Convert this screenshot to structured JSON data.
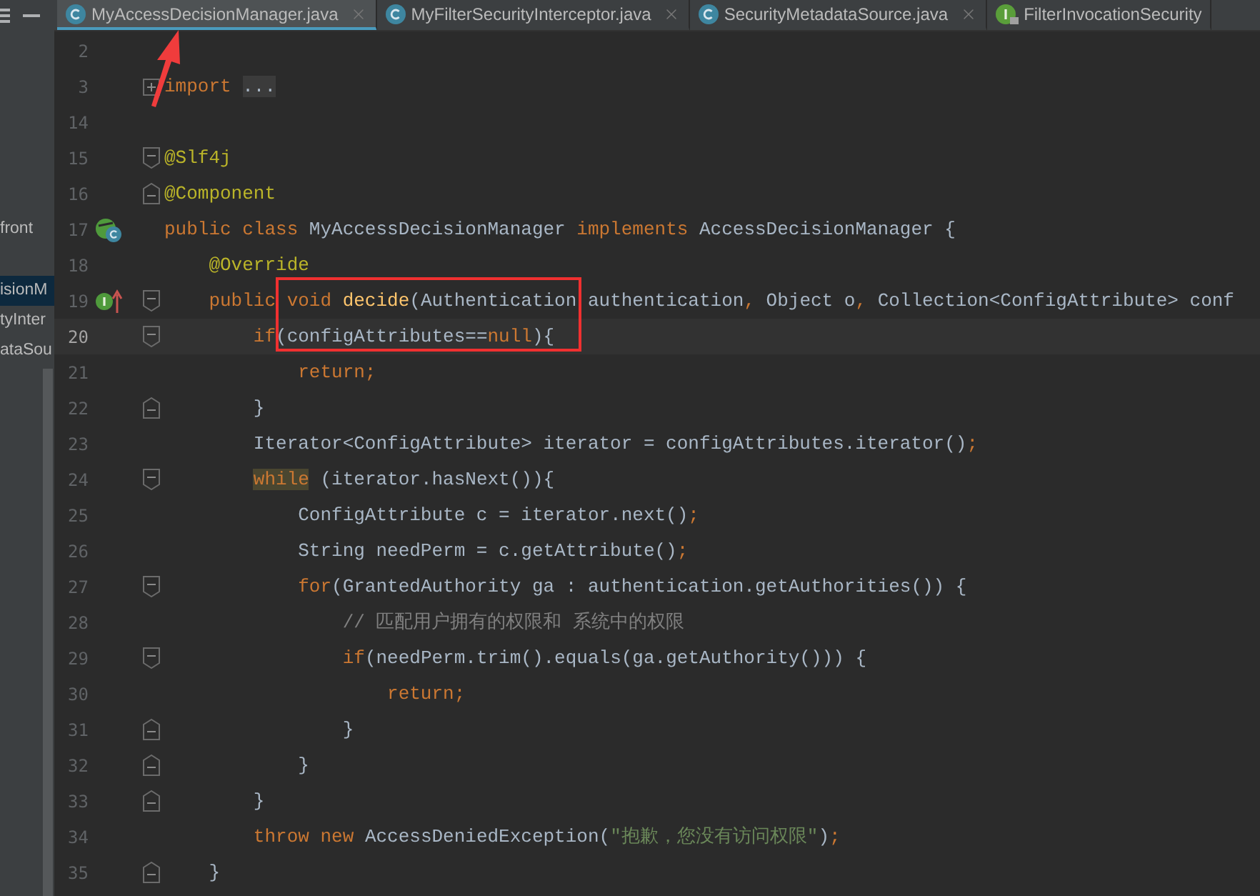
{
  "sidebar": {
    "items": [
      {
        "label": "front",
        "selected": false
      },
      {
        "label": "isionM",
        "selected": true
      },
      {
        "label": "tyInter",
        "selected": false
      },
      {
        "label": "ataSou",
        "selected": false
      }
    ]
  },
  "tabs": [
    {
      "label": "MyAccessDecisionManager.java",
      "kind": "class",
      "selected": true,
      "closable": true
    },
    {
      "label": "MyFilterSecurityInterceptor.java",
      "kind": "class",
      "selected": false,
      "closable": true
    },
    {
      "label": "SecurityMetadataSource.java",
      "kind": "class",
      "selected": false,
      "closable": true
    },
    {
      "label": "FilterInvocationSecurity",
      "kind": "interface",
      "selected": false,
      "closable": false
    }
  ],
  "editor": {
    "lines": [
      {
        "number": "2",
        "current": false
      },
      {
        "number": "3",
        "current": false,
        "markers": [
          {
            "kind": "fold_collapsed"
          }
        ],
        "tokens": [
          {
            "kind": "keyword",
            "text": "import "
          },
          {
            "kind": "folded",
            "text": "..."
          }
        ]
      },
      {
        "number": "14",
        "current": false
      },
      {
        "number": "15",
        "current": false,
        "markers": [
          {
            "kind": "fold_start"
          }
        ],
        "tokens": [
          {
            "kind": "annotation",
            "text": "@Slf4j"
          }
        ]
      },
      {
        "number": "16",
        "current": false,
        "markers": [
          {
            "kind": "fold_end"
          }
        ],
        "tokens": [
          {
            "kind": "annotation",
            "text": "@Component"
          }
        ]
      },
      {
        "number": "17",
        "current": false,
        "markers": [
          {
            "kind": "class_implements"
          }
        ],
        "tokens": [
          {
            "kind": "keyword",
            "text": "public class "
          },
          {
            "kind": "plain",
            "text": "MyAccessDecisionManager "
          },
          {
            "kind": "keyword",
            "text": "implements "
          },
          {
            "kind": "plain",
            "text": "AccessDecisionManager {"
          }
        ]
      },
      {
        "number": "18",
        "current": false,
        "tokens": [
          {
            "kind": "annotation",
            "text": "    @Override"
          }
        ]
      },
      {
        "number": "19",
        "current": false,
        "markers": [
          {
            "kind": "method_implements"
          },
          {
            "kind": "fold_start"
          }
        ],
        "tokens": [
          {
            "kind": "keyword",
            "text": "    public void "
          },
          {
            "kind": "method",
            "text": "decide"
          },
          {
            "kind": "plain",
            "text": "(Authentication authentication"
          },
          {
            "kind": "keyword",
            "text": ", "
          },
          {
            "kind": "plain",
            "text": "Object o"
          },
          {
            "kind": "keyword",
            "text": ", "
          },
          {
            "kind": "plain",
            "text": "Collection<ConfigAttribute> conf"
          }
        ]
      },
      {
        "number": "20",
        "current": true,
        "markers": [
          {
            "kind": "fold_start"
          }
        ],
        "tokens": [
          {
            "kind": "keyword",
            "text": "        if"
          },
          {
            "kind": "plain",
            "text": "(configAttributes=="
          },
          {
            "kind": "keyword",
            "text": "null"
          },
          {
            "kind": "plain",
            "text": "){"
          }
        ]
      },
      {
        "number": "21",
        "current": false,
        "tokens": [
          {
            "kind": "keyword",
            "text": "            return;"
          }
        ]
      },
      {
        "number": "22",
        "current": false,
        "markers": [
          {
            "kind": "fold_end"
          }
        ],
        "tokens": [
          {
            "kind": "plain",
            "text": "        }"
          }
        ]
      },
      {
        "number": "23",
        "current": false,
        "tokens": [
          {
            "kind": "plain",
            "text": "        Iterator<ConfigAttribute> iterator = configAttributes.iterator()"
          },
          {
            "kind": "keyword",
            "text": ";"
          }
        ]
      },
      {
        "number": "24",
        "current": false,
        "markers": [
          {
            "kind": "fold_start"
          }
        ],
        "tokens": [
          {
            "kind": "match",
            "text": "        while"
          },
          {
            "kind": "plain",
            "text": " (iterator.hasNext()){"
          }
        ]
      },
      {
        "number": "25",
        "current": false,
        "tokens": [
          {
            "kind": "plain",
            "text": "            ConfigAttribute c = iterator.next()"
          },
          {
            "kind": "keyword",
            "text": ";"
          }
        ]
      },
      {
        "number": "26",
        "current": false,
        "tokens": [
          {
            "kind": "plain",
            "text": "            String needPerm = c.getAttribute()"
          },
          {
            "kind": "keyword",
            "text": ";"
          }
        ]
      },
      {
        "number": "27",
        "current": false,
        "markers": [
          {
            "kind": "fold_start"
          }
        ],
        "tokens": [
          {
            "kind": "keyword",
            "text": "            for"
          },
          {
            "kind": "plain",
            "text": "(GrantedAuthority ga : authentication.getAuthorities()) {"
          }
        ]
      },
      {
        "number": "28",
        "current": false,
        "tokens": [
          {
            "kind": "comment",
            "text": "                // 匹配用户拥有的权限和 系统中的权限"
          }
        ]
      },
      {
        "number": "29",
        "current": false,
        "markers": [
          {
            "kind": "fold_start"
          }
        ],
        "tokens": [
          {
            "kind": "keyword",
            "text": "                if"
          },
          {
            "kind": "plain",
            "text": "(needPerm.trim().equals(ga.getAuthority())) {"
          }
        ]
      },
      {
        "number": "30",
        "current": false,
        "tokens": [
          {
            "kind": "keyword",
            "text": "                    return;"
          }
        ]
      },
      {
        "number": "31",
        "current": false,
        "markers": [
          {
            "kind": "fold_end"
          }
        ],
        "tokens": [
          {
            "kind": "plain",
            "text": "                }"
          }
        ]
      },
      {
        "number": "32",
        "current": false,
        "markers": [
          {
            "kind": "fold_end"
          }
        ],
        "tokens": [
          {
            "kind": "plain",
            "text": "            }"
          }
        ]
      },
      {
        "number": "33",
        "current": false,
        "markers": [
          {
            "kind": "fold_end"
          }
        ],
        "tokens": [
          {
            "kind": "plain",
            "text": "        }"
          }
        ]
      },
      {
        "number": "34",
        "current": false,
        "tokens": [
          {
            "kind": "keyword",
            "text": "        throw new "
          },
          {
            "kind": "plain",
            "text": "AccessDeniedException("
          },
          {
            "kind": "string",
            "text": "\"抱歉，您没有访问权限\""
          },
          {
            "kind": "plain",
            "text": ")"
          },
          {
            "kind": "keyword",
            "text": ";"
          }
        ]
      },
      {
        "number": "35",
        "current": false,
        "markers": [
          {
            "kind": "fold_end"
          }
        ],
        "tokens": [
          {
            "kind": "plain",
            "text": "    }"
          }
        ]
      }
    ]
  }
}
